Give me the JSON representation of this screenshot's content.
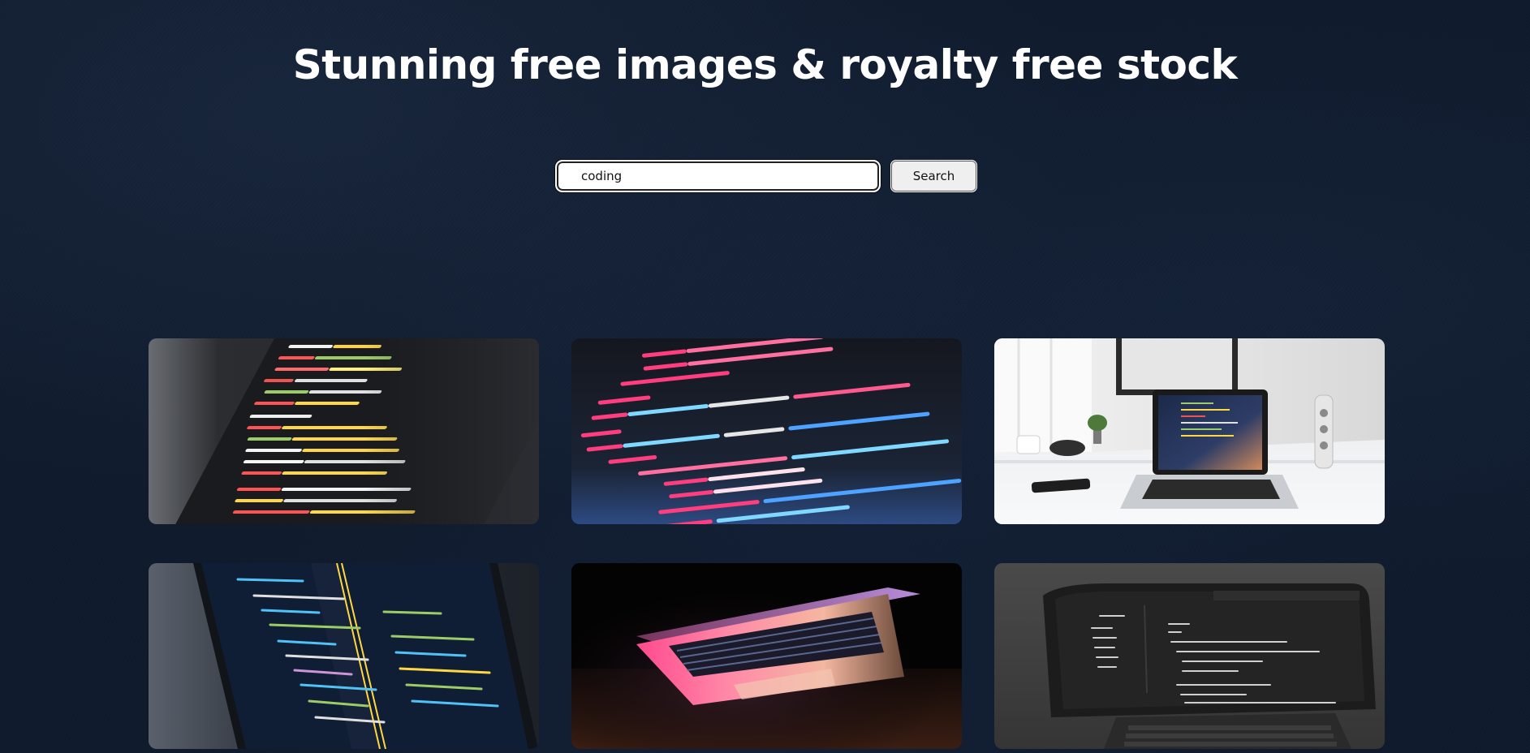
{
  "header": {
    "title": "Stunning free images & royalty free stock"
  },
  "search": {
    "value": "coding",
    "button_label": "Search"
  },
  "results": [
    {
      "subject": "code-editor-closeup"
    },
    {
      "subject": "svg-code-closeup"
    },
    {
      "subject": "laptop-on-desk"
    },
    {
      "subject": "laptop-code-editor"
    },
    {
      "subject": "glowing-laptop"
    },
    {
      "subject": "grayscale-laptop-code"
    }
  ]
}
